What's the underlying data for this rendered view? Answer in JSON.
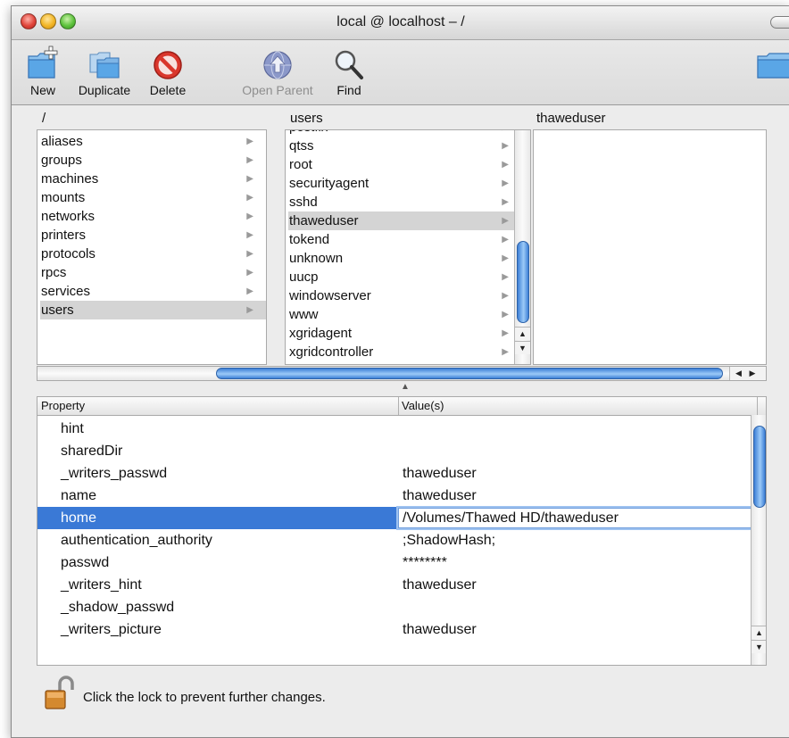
{
  "window": {
    "title": "local @ localhost – /"
  },
  "toolbar": {
    "new_label": "New",
    "duplicate_label": "Duplicate",
    "delete_label": "Delete",
    "open_parent_label": "Open Parent",
    "find_label": "Find"
  },
  "browser": {
    "col1_header": "/",
    "col2_header": "users",
    "col3_header": "thaweduser",
    "col1_items": [
      "aliases",
      "groups",
      "machines",
      "mounts",
      "networks",
      "printers",
      "protocols",
      "rpcs",
      "services",
      "users"
    ],
    "col1_selected": "users",
    "col2_items": [
      "postfix",
      "qtss",
      "root",
      "securityagent",
      "sshd",
      "thaweduser",
      "tokend",
      "unknown",
      "uucp",
      "windowserver",
      "www",
      "xgridagent",
      "xgridcontroller"
    ],
    "col2_selected": "thaweduser",
    "col3_items": []
  },
  "properties": {
    "header_property": "Property",
    "header_values": "Value(s)",
    "rows": [
      {
        "name": "hint",
        "value": ""
      },
      {
        "name": "sharedDir",
        "value": ""
      },
      {
        "name": "_writers_passwd",
        "value": "thaweduser"
      },
      {
        "name": "name",
        "value": "thaweduser"
      },
      {
        "name": "home",
        "value": "/Volumes/Thawed HD/thaweduser"
      },
      {
        "name": "authentication_authority",
        "value": ";ShadowHash;"
      },
      {
        "name": "passwd",
        "value": "********"
      },
      {
        "name": "_writers_hint",
        "value": "thaweduser"
      },
      {
        "name": "_shadow_passwd",
        "value": ""
      },
      {
        "name": "_writers_picture",
        "value": "thaweduser"
      }
    ],
    "selected_row": "home"
  },
  "lock": {
    "message": "Click the lock to prevent further changes."
  },
  "colors": {
    "selection_blue": "#3a79d6",
    "scroll_blue": "#3d7fd6",
    "browser_selection": "#d4d4d4"
  },
  "icons": {
    "new": "new-folder-icon",
    "duplicate": "duplicate-folders-icon",
    "delete": "delete-no-entry-icon",
    "open_parent": "globe-up-arrow-icon",
    "find": "magnifier-icon",
    "lock": "open-padlock-icon"
  }
}
